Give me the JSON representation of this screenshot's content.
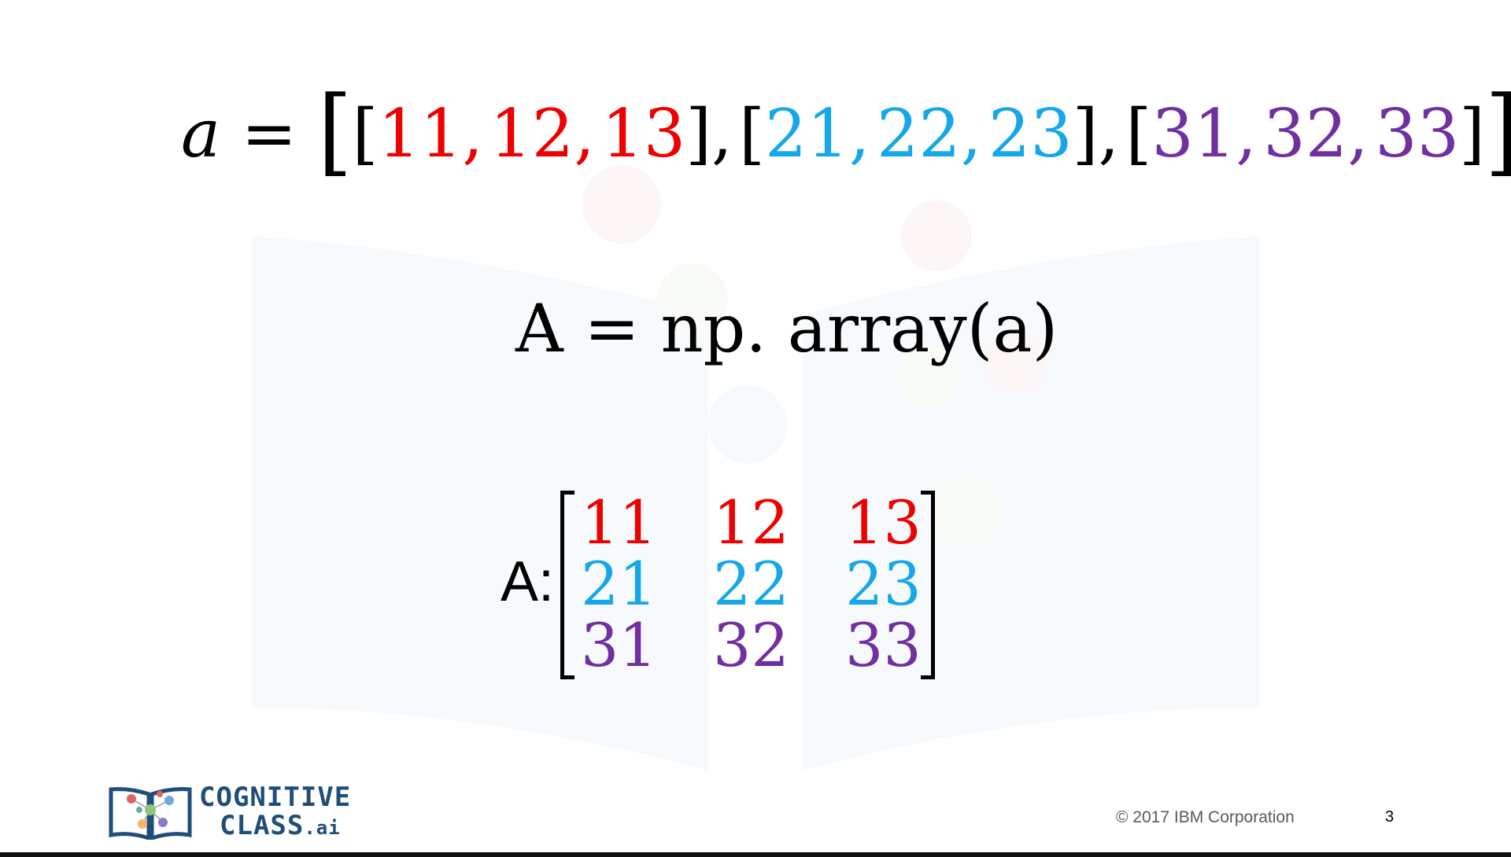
{
  "slide": {
    "list_line": {
      "var": "a",
      "equals": "=",
      "open_outer": "[",
      "close_outer": "]",
      "row1": [
        "11",
        "12",
        "13"
      ],
      "row2": [
        "21",
        "22",
        "23"
      ],
      "row3": [
        "31",
        "32",
        "33"
      ],
      "open_inner": "[",
      "close_inner": "]",
      "comma": ","
    },
    "array_line": "A = np. array(a)",
    "matrix": {
      "label": "A:",
      "rows": [
        [
          "11",
          "12",
          "13"
        ],
        [
          "21",
          "22",
          "23"
        ],
        [
          "31",
          "32",
          "33"
        ]
      ]
    },
    "footer": {
      "logo_line1": "COGNITIVE",
      "logo_line2": "CLASS",
      "logo_suffix": ".ai",
      "copyright": "© 2017 IBM Corporation",
      "page_number": "3"
    }
  },
  "colors": {
    "row1": "#ee0000",
    "row2": "#16a7e8",
    "row3": "#7030a0",
    "logo": "#1f4e79"
  }
}
